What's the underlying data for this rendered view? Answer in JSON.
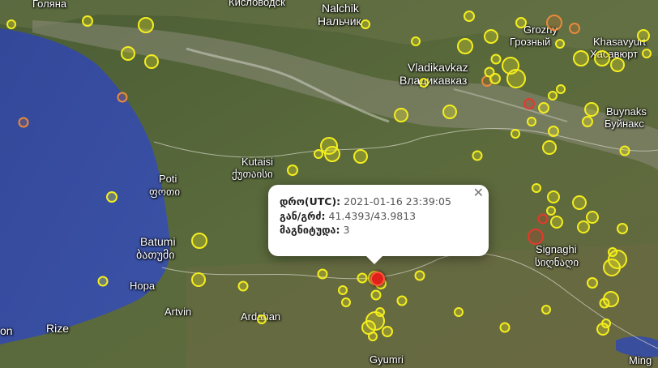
{
  "map": {
    "labels": {
      "kislovodsk": "Кисловодск",
      "nalchik_en": "Nalchik",
      "nalchik_ru": "Нальчик",
      "grozny_en": "Grozny",
      "grozny_ru": "Грозный",
      "khasavyurt_en": "Khasavyurt",
      "khasavyurt_ru": "Хасавюрт",
      "vladikavkaz_en": "Vladikavkaz",
      "vladikavkaz_ru": "Владикавказ",
      "buynaksk_en": "Buynaks",
      "buynaksk_ru": "Буйнакс",
      "kutaisi_en": "Kutaisi",
      "kutaisi_ka": "ქუთაისი",
      "poti_en": "Poti",
      "poti_ka": "ფოთი",
      "batumi_en": "Batumi",
      "batumi_ka": "ბათუმი",
      "hopa": "Hopa",
      "artvin": "Artvin",
      "ardahan": "Ardahan",
      "rize": "Rize",
      "gyumri": "Gyumri",
      "signaghi_en": "Signaghi",
      "signaghi_ka": "სიღნაღი",
      "top_left": "Голяна",
      "bottom_left": "on",
      "bottom_right": "Ming"
    },
    "colors": {
      "sea": "#3a4e9e",
      "land": "#55653a",
      "marker_yellow": "#f4ee1e",
      "marker_orange": "#e88a3c",
      "marker_red": "#e23a2c"
    }
  },
  "popup": {
    "time_label": "დრო(UTC):",
    "time_value": "2021-01-16 23:39:05",
    "coords_label": "გან/გრძ:",
    "coords_value": "41.4393/43.9813",
    "magnitude_label": "მაგნიტუდა:",
    "magnitude_value": "3",
    "close_icon": "close-x"
  }
}
